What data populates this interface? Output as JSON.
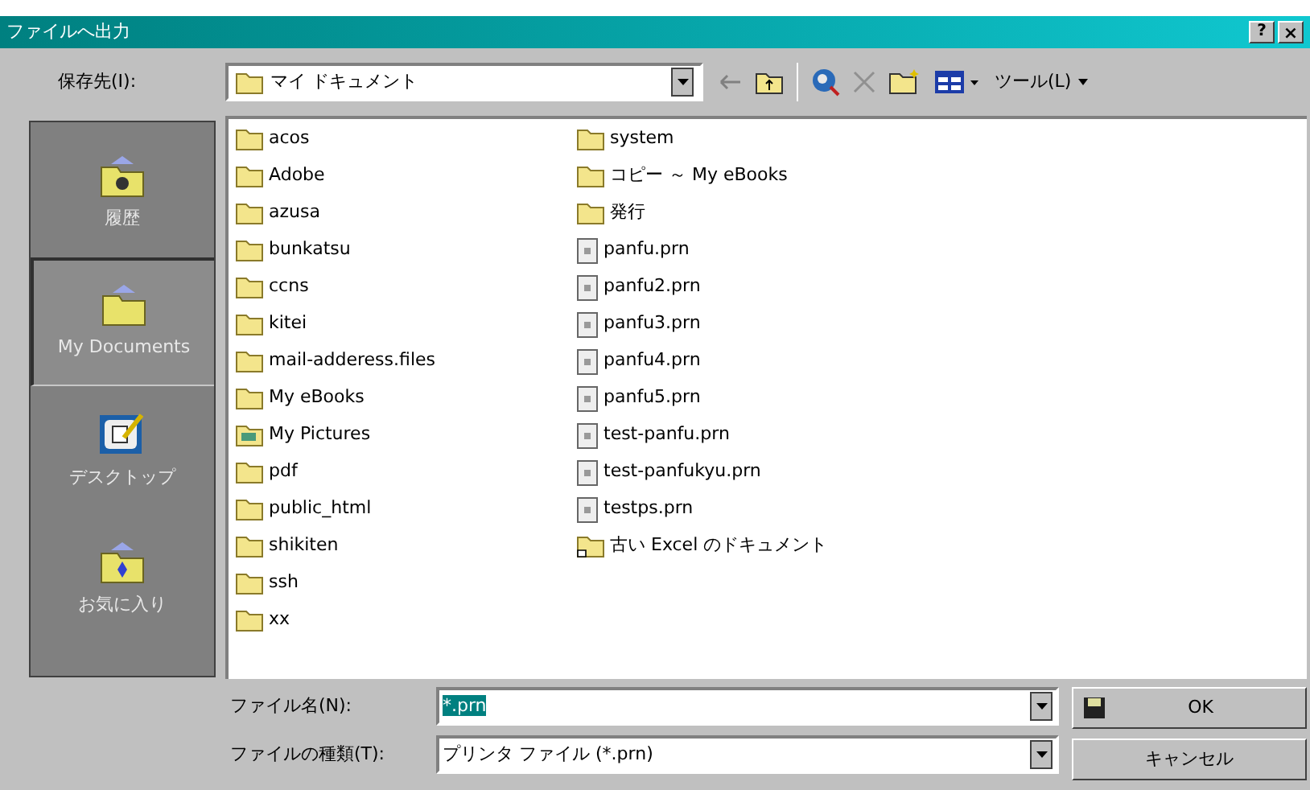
{
  "window": {
    "title": "ファイルへ出力",
    "help_button": "?",
    "close_button": "×"
  },
  "toolbar": {
    "label": "保存先(I):",
    "location": "マイ ドキュメント",
    "tools_menu": "ツール(L)"
  },
  "places": [
    {
      "label": "履歴",
      "kind": "history",
      "selected": false
    },
    {
      "label": "My Documents",
      "kind": "documents",
      "selected": true
    },
    {
      "label": "デスクトップ",
      "kind": "desktop",
      "selected": false
    },
    {
      "label": "お気に入り",
      "kind": "favorites",
      "selected": false
    }
  ],
  "files": {
    "columns": [
      [
        {
          "name": "acos",
          "kind": "folder"
        },
        {
          "name": "Adobe",
          "kind": "folder"
        },
        {
          "name": "azusa",
          "kind": "folder"
        },
        {
          "name": "bunkatsu",
          "kind": "folder"
        },
        {
          "name": "ccns",
          "kind": "folder"
        },
        {
          "name": "kitei",
          "kind": "folder"
        },
        {
          "name": "mail-adderess.files",
          "kind": "folder"
        },
        {
          "name": "My eBooks",
          "kind": "folder"
        },
        {
          "name": "My Pictures",
          "kind": "pictures"
        },
        {
          "name": "pdf",
          "kind": "folder"
        },
        {
          "name": "public_html",
          "kind": "folder"
        },
        {
          "name": "shikiten",
          "kind": "folder"
        },
        {
          "name": "ssh",
          "kind": "folder"
        },
        {
          "name": "xx",
          "kind": "folder"
        }
      ],
      [
        {
          "name": "system",
          "kind": "folder"
        },
        {
          "name": "コピー ～ My eBooks",
          "kind": "folder"
        },
        {
          "name": "発行",
          "kind": "folder"
        },
        {
          "name": "panfu.prn",
          "kind": "file"
        },
        {
          "name": "panfu2.prn",
          "kind": "file"
        },
        {
          "name": "panfu3.prn",
          "kind": "file"
        },
        {
          "name": "panfu4.prn",
          "kind": "file"
        },
        {
          "name": "panfu5.prn",
          "kind": "file"
        },
        {
          "name": "test-panfu.prn",
          "kind": "file"
        },
        {
          "name": "test-panfukyu.prn",
          "kind": "file"
        },
        {
          "name": "testps.prn",
          "kind": "file"
        },
        {
          "name": "古い Excel のドキュメント",
          "kind": "shortcut-folder"
        }
      ]
    ]
  },
  "filename": {
    "label": "ファイル名(N):",
    "value": "*.prn",
    "selected": true
  },
  "filetype": {
    "label": "ファイルの種類(T):",
    "value": "プリンタ ファイル (*.prn)"
  },
  "buttons": [
    {
      "label": "OK",
      "kind": "save"
    },
    {
      "label": "キャンセル",
      "kind": "cancel"
    }
  ]
}
